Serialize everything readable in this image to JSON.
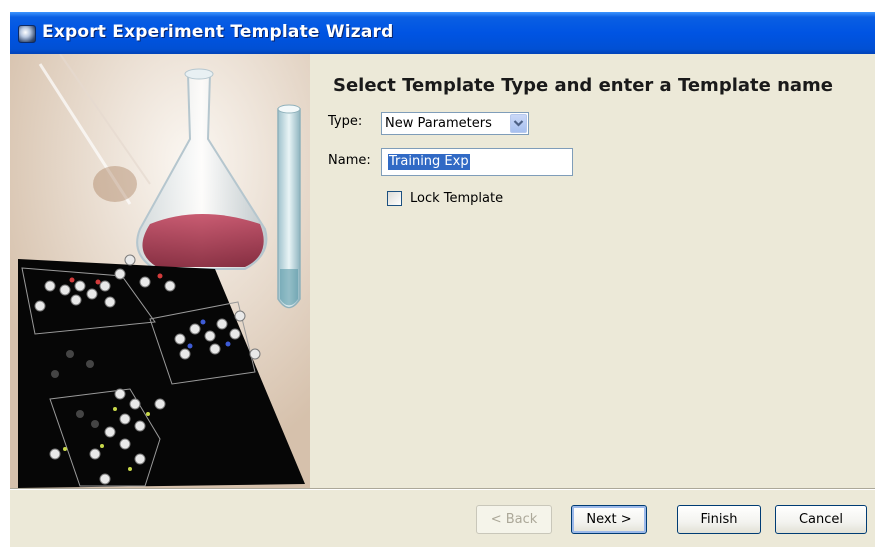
{
  "window": {
    "title": "Export Experiment Template Wizard",
    "icon": "app-icon"
  },
  "wizard": {
    "heading": "Select Template Type and enter a Template name",
    "type_label": "Type:",
    "type_value": "New Parameters",
    "name_label": "Name:",
    "name_value": "Training Exp",
    "lock_label": "Lock Template",
    "lock_checked": false
  },
  "buttons": {
    "back": "< Back",
    "next": "Next >",
    "finish": "Finish",
    "cancel": "Cancel"
  },
  "colors": {
    "titlebar": "#0054e3",
    "selection": "#316ac5",
    "dialog_bg": "#ece9d8"
  }
}
